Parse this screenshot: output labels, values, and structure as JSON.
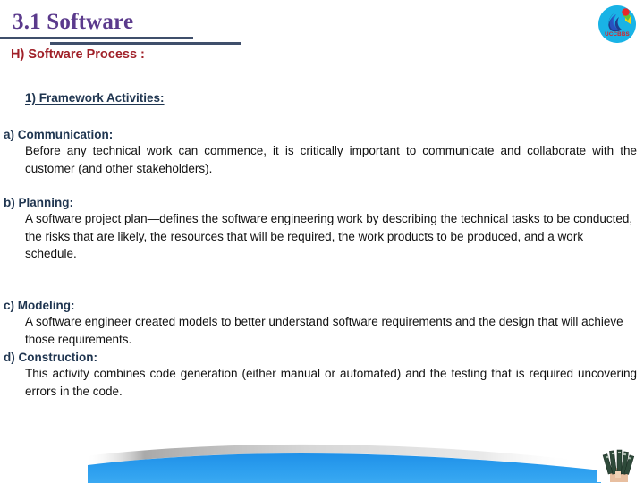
{
  "slide": {
    "title": "3.1 Software",
    "logo": {
      "name": "uccbbs-logo",
      "text": "UCCBBS",
      "bg_color": "#19b3e6",
      "flame_color": "#1f3f8f",
      "dot_color": "#e8262a",
      "wedge_color": "#f5d416",
      "text_color": "#d8232a"
    },
    "heading": "H) Software Process :",
    "subheading": "1) Framework Activities:",
    "sections": [
      {
        "id": "communication",
        "label": "a) Communication:",
        "body": "Before any technical work can commence, it is critically important to communicate and collaborate with the customer (and other stakeholders)."
      },
      {
        "id": "planning",
        "label": "b) Planning:",
        "body": "A software project plan—defines the software engineering work by describing the technical tasks to be conducted, the risks that are likely, the resources that will be required, the work products to be produced, and a work schedule."
      },
      {
        "id": "modeling",
        "label": "c) Modeling:",
        "body": "A software engineer created models to better understand software requirements and the design that will achieve those requirements."
      },
      {
        "id": "construction",
        "label": "d) Construction:",
        "body": "This activity combines code generation (either manual or automated) and the testing that is required uncovering errors in the code."
      }
    ],
    "colors": {
      "title": "#5b3a8c",
      "rule": "#3f4f6b",
      "heading": "#a02028",
      "subheading": "#1f3550",
      "section_label": "#1f3550",
      "body": "#111111",
      "wave": "#2196e8",
      "wave_shadow": "#b8b8b8"
    }
  }
}
